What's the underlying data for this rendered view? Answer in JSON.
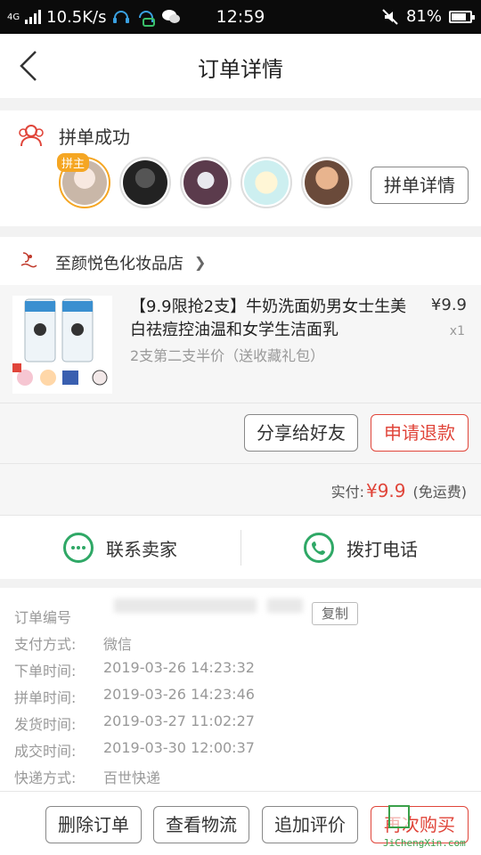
{
  "status_bar": {
    "network": "4G",
    "speed": "10.5K/s",
    "time": "12:59",
    "battery": "81%",
    "battery_level": 0.81
  },
  "header": {
    "title": "订单详情"
  },
  "group": {
    "title": "拼单成功",
    "leader_badge": "拼主",
    "detail_button": "拼单详情"
  },
  "shop": {
    "name": "至颜悦色化妆品店"
  },
  "product": {
    "name": "【9.9限抢2支】牛奶洗面奶男女士生美白祛痘控油温和女学生洁面乳",
    "spec": "2支第二支半价（送收藏礼包）",
    "price": "¥9.9",
    "quantity": "x1"
  },
  "actions": {
    "share": "分享给好友",
    "refund": "申请退款"
  },
  "payment": {
    "label": "实付:",
    "amount": "¥9.9",
    "shipping": "(免运费)"
  },
  "contact": {
    "seller": "联系卖家",
    "call": "拨打电话"
  },
  "order_info": {
    "copy_button": "复制",
    "rows": [
      {
        "k": "订单编号",
        "v": ""
      },
      {
        "k": "支付方式:",
        "v": "微信"
      },
      {
        "k": "下单时间:",
        "v": "2019-03-26 14:23:32"
      },
      {
        "k": "拼单时间:",
        "v": "2019-03-26 14:23:46"
      },
      {
        "k": "发货时间:",
        "v": "2019-03-27 11:02:27"
      },
      {
        "k": "成交时间:",
        "v": "2019-03-30 12:00:37"
      },
      {
        "k": "快递方式:",
        "v": "百世快递"
      }
    ]
  },
  "bottom": {
    "delete": "删除订单",
    "logistics": "查看物流",
    "review": "追加评价",
    "rebuy": "再次购买"
  },
  "watermark": {
    "text": "JiChengXin.com"
  },
  "colors": {
    "accent_red": "#e0453a",
    "leader_orange": "#f5a623",
    "green": "#2fa866"
  }
}
